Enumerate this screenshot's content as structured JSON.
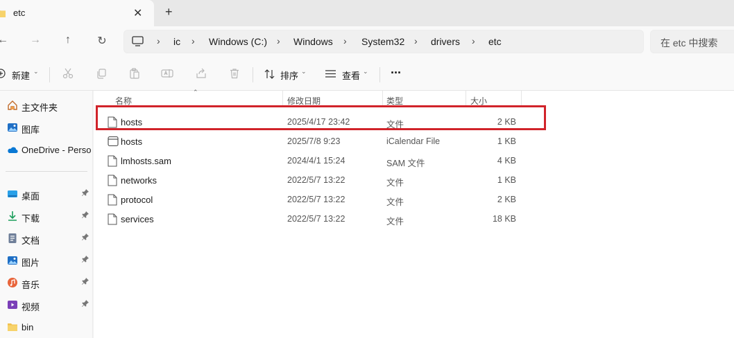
{
  "window": {
    "tab_title": "etc",
    "close_symbol": "✕",
    "newtab_symbol": "+"
  },
  "nav": {
    "back_symbol": "←",
    "forward_symbol": "→",
    "up_symbol": "↑",
    "refresh_symbol": "↻",
    "breadcrumbs": [
      "ic",
      "Windows (C:)",
      "Windows",
      "System32",
      "drivers",
      "etc"
    ],
    "separator": "›",
    "search_placeholder": "在 etc 中搜索"
  },
  "toolbar": {
    "new_label": "新建",
    "sort_label": "排序",
    "view_label": "查看",
    "more_label": "···",
    "icons": [
      "cut-icon",
      "copy-icon",
      "paste-icon",
      "rename-icon",
      "share-icon",
      "delete-icon"
    ]
  },
  "sidebar": {
    "items": [
      {
        "label": "主文件夹",
        "icon": "home-icon",
        "pinned": false
      },
      {
        "label": "图库",
        "icon": "gallery-icon",
        "pinned": false
      },
      {
        "label": "OneDrive - Perso",
        "icon": "onedrive-icon",
        "pinned": false
      },
      {
        "label": "桌面",
        "icon": "desktop-icon",
        "pinned": true
      },
      {
        "label": "下载",
        "icon": "download-icon",
        "pinned": true
      },
      {
        "label": "文档",
        "icon": "documents-icon",
        "pinned": true
      },
      {
        "label": "图片",
        "icon": "pictures-icon",
        "pinned": true
      },
      {
        "label": "音乐",
        "icon": "music-icon",
        "pinned": true
      },
      {
        "label": "视频",
        "icon": "videos-icon",
        "pinned": true
      },
      {
        "label": "bin",
        "icon": "folder-icon",
        "pinned": false
      }
    ],
    "pin_symbol": "📌"
  },
  "files": {
    "columns": {
      "name": "名称",
      "date": "修改日期",
      "type": "类型",
      "size": "大小"
    },
    "rows": [
      {
        "name": "hosts",
        "date": "2025/4/17 23:42",
        "type": "文件",
        "size": "2 KB",
        "icon": "file-icon",
        "highlighted": true
      },
      {
        "name": "hosts",
        "date": "2025/7/8 9:23",
        "type": "iCalendar File",
        "size": "1 KB",
        "icon": "calendar-file-icon",
        "highlighted": false
      },
      {
        "name": "lmhosts.sam",
        "date": "2024/4/1 15:24",
        "type": "SAM 文件",
        "size": "4 KB",
        "icon": "file-icon",
        "highlighted": false
      },
      {
        "name": "networks",
        "date": "2022/5/7 13:22",
        "type": "文件",
        "size": "1 KB",
        "icon": "file-icon",
        "highlighted": false
      },
      {
        "name": "protocol",
        "date": "2022/5/7 13:22",
        "type": "文件",
        "size": "2 KB",
        "icon": "file-icon",
        "highlighted": false
      },
      {
        "name": "services",
        "date": "2022/5/7 13:22",
        "type": "文件",
        "size": "18 KB",
        "icon": "file-icon",
        "highlighted": false
      }
    ]
  },
  "colors": {
    "highlight_border": "#d1232a",
    "accent": "#0067c0"
  }
}
